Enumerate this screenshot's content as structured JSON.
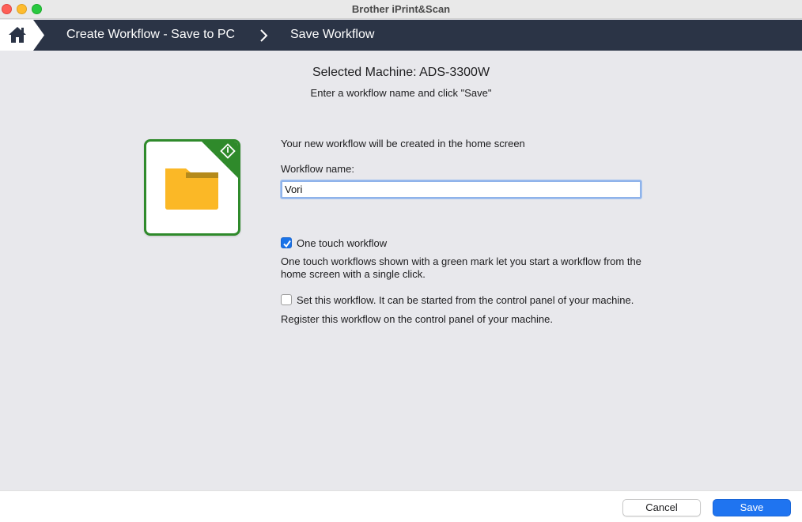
{
  "window": {
    "title": "Brother iPrint&Scan"
  },
  "nav": {
    "crumbs": [
      "Create Workflow - Save to PC",
      "Save Workflow"
    ]
  },
  "main": {
    "heading": "Selected Machine: ADS-3300W",
    "subheading": "Enter a workflow name and click \"Save\"",
    "intro": "Your new workflow will be created in the home screen",
    "name_label": "Workflow name:",
    "name_value": "Vori",
    "one_touch": {
      "checked": true,
      "label": "One touch workflow",
      "description": "One touch workflows shown with a green mark let you start a workflow from the home screen with a single click."
    },
    "control_panel": {
      "checked": false,
      "label": "Set this workflow. It can be started from the control panel of your machine.",
      "description": "Register this workflow on the control panel of your machine."
    }
  },
  "footer": {
    "cancel_label": "Cancel",
    "save_label": "Save"
  },
  "colors": {
    "nav_bg": "#2b3446",
    "accent_green": "#2f8a2b",
    "folder": "#fbb826",
    "primary_blue": "#1f74f0"
  }
}
